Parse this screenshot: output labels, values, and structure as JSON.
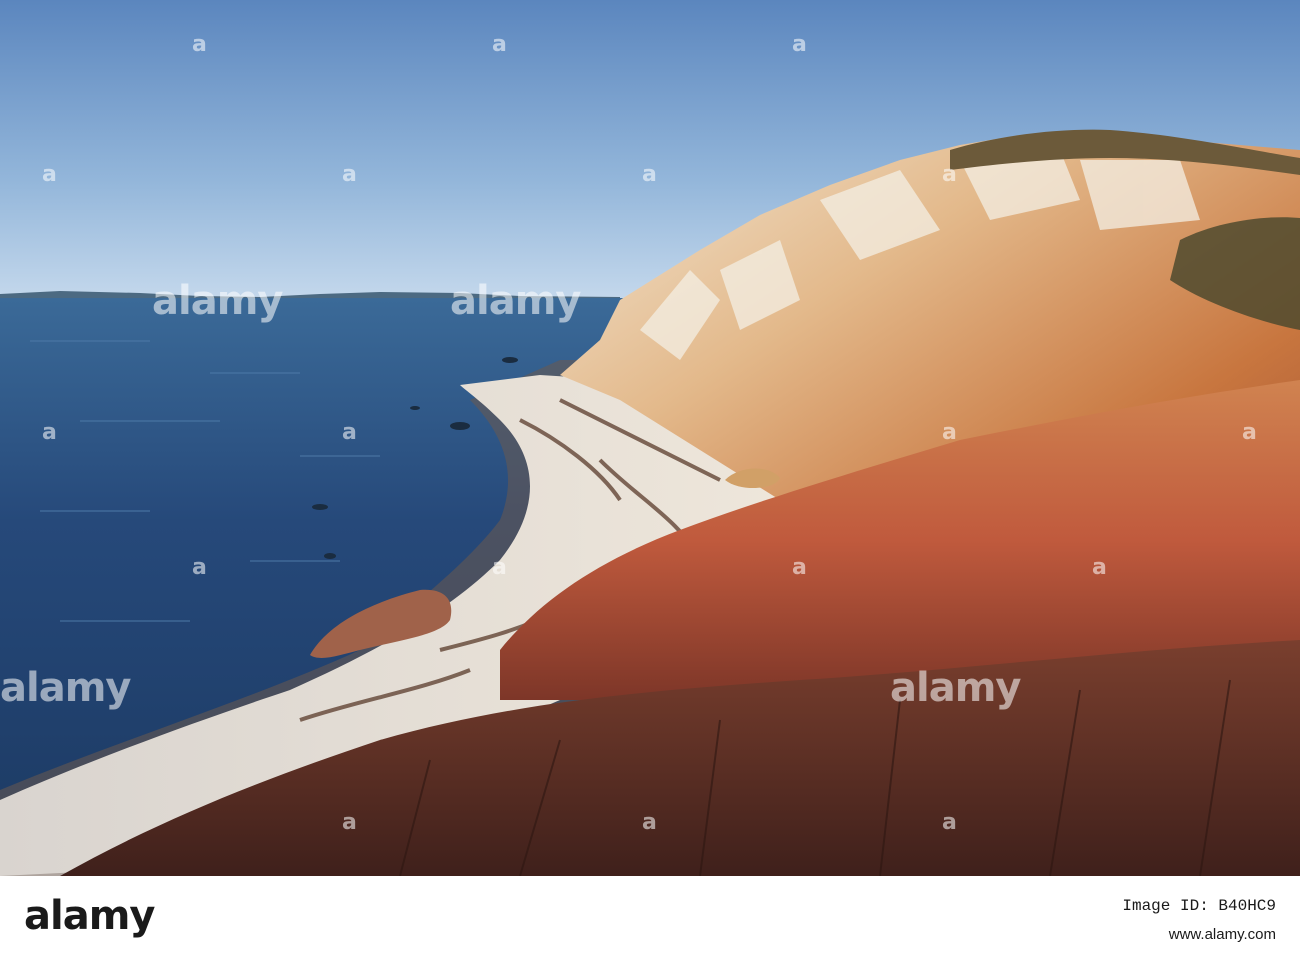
{
  "watermark": {
    "brand": "alamy",
    "repeat_mark": "a"
  },
  "footer": {
    "logo_text": "alamy",
    "image_id": "Image ID: B40HC9",
    "site": "www.alamy.com"
  },
  "colors": {
    "sky_top": "#5e88c0",
    "sky_bottom": "#b9d3ea",
    "sea": "#24466e",
    "sand": "#e7e0d6",
    "cliff_light": "#f0e4cf",
    "cliff_orange": "#d4874d",
    "cliff_red": "#b5503a",
    "scrub": "#5b2f25"
  }
}
